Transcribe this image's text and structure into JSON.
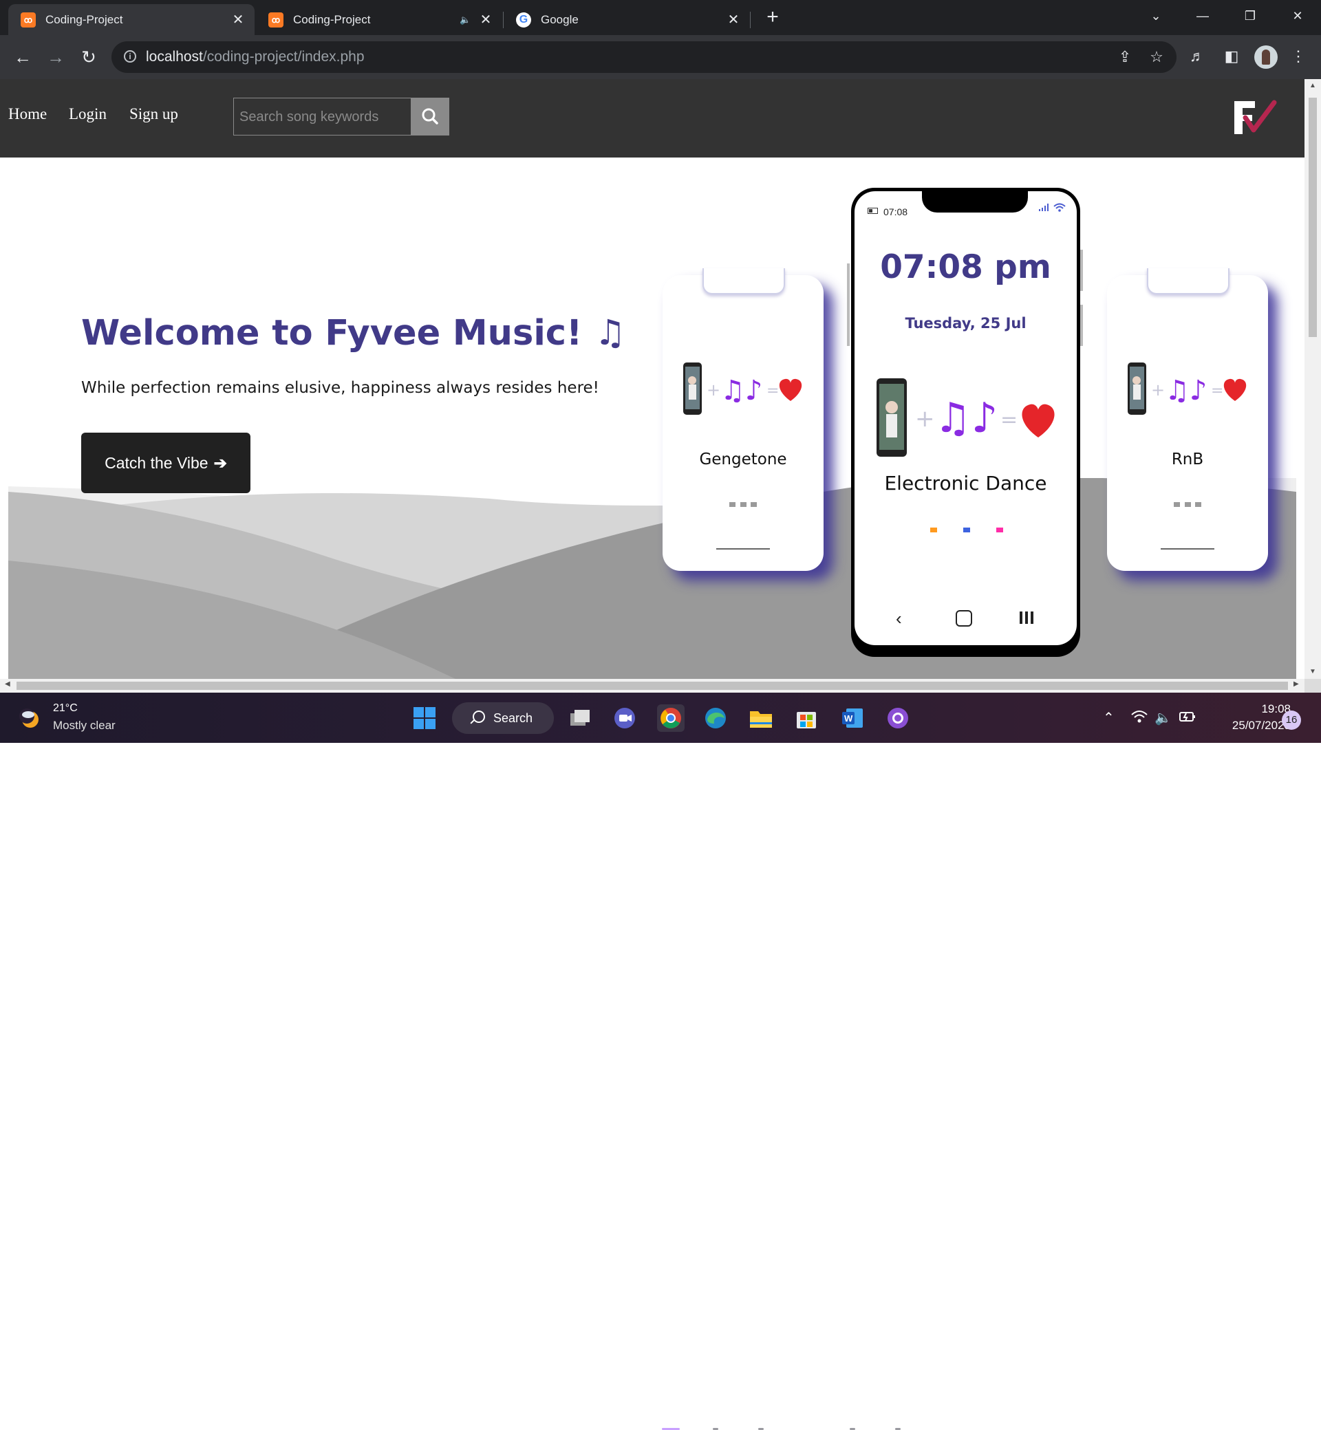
{
  "browser": {
    "tabs": [
      {
        "title": "Coding-Project",
        "favicon": "xampp-icon",
        "active": true
      },
      {
        "title": "Coding-Project",
        "favicon": "xampp-icon",
        "active": false,
        "audio": true
      },
      {
        "title": "Google",
        "favicon": "google-icon",
        "active": false
      }
    ],
    "url_host": "localhost",
    "url_path": "/coding-project/index.php"
  },
  "site": {
    "nav": [
      "Home",
      "Login",
      "Sign up"
    ],
    "search_placeholder": "Search song keywords",
    "hero_title": "Welcome to Fyvee Music! ♫",
    "hero_subtitle": "While perfection remains elusive, happiness always resides here!",
    "cta_label": "Catch the Vibe",
    "cta_arrow": "➔",
    "phone_left_genre": "Gengetone",
    "phone_right_genre": "RnB",
    "phone_main": {
      "status_time": "07:08",
      "clock": "07:08 pm",
      "date": "Tuesday, 25 Jul",
      "genre": "Electronic Dance",
      "carousel_dot_colors": [
        "#ff9a1f",
        "#3d63e0",
        "#ff2da8"
      ]
    },
    "colors": {
      "accent": "#413a88",
      "nav_bg": "#333333",
      "logo_check": "#b5264f"
    }
  },
  "taskbar": {
    "temperature": "21°C",
    "weather": "Mostly clear",
    "search_label": "Search",
    "time": "19:08",
    "date": "25/07/2023",
    "notifications": "16"
  }
}
